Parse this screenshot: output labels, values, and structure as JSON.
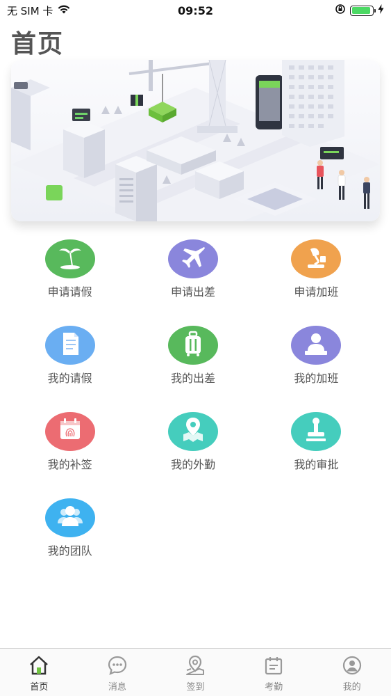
{
  "status_bar": {
    "carrier": "无 SIM 卡",
    "time": "09:52",
    "battery_level": 0.9
  },
  "page": {
    "title": "首页"
  },
  "grid": {
    "items": [
      {
        "label": "申请请假",
        "icon": "beach-icon",
        "color": "#58b95c"
      },
      {
        "label": "申请出差",
        "icon": "airplane-icon",
        "color": "#8a86dc"
      },
      {
        "label": "申请加班",
        "icon": "desk-lamp-icon",
        "color": "#f0a24e"
      },
      {
        "label": "我的请假",
        "icon": "document-icon",
        "color": "#6aaef2"
      },
      {
        "label": "我的出差",
        "icon": "luggage-icon",
        "color": "#58b95c"
      },
      {
        "label": "我的加班",
        "icon": "person-desk-icon",
        "color": "#8a86dc"
      },
      {
        "label": "我的补签",
        "icon": "fingerprint-calendar-icon",
        "color": "#ec6c72"
      },
      {
        "label": "我的外勤",
        "icon": "map-pin-icon",
        "color": "#45cdbd"
      },
      {
        "label": "我的审批",
        "icon": "stamp-icon",
        "color": "#45cdbd"
      },
      {
        "label": "我的团队",
        "icon": "team-icon",
        "color": "#3eb2f0"
      }
    ]
  },
  "tab_bar": {
    "active_index": 0,
    "active_color": "#333333",
    "inactive_color": "#888888",
    "tabs": [
      {
        "label": "首页",
        "icon": "home-icon"
      },
      {
        "label": "消息",
        "icon": "message-icon"
      },
      {
        "label": "签到",
        "icon": "location-pin-icon"
      },
      {
        "label": "考勤",
        "icon": "attendance-icon"
      },
      {
        "label": "我的",
        "icon": "profile-icon"
      }
    ]
  }
}
